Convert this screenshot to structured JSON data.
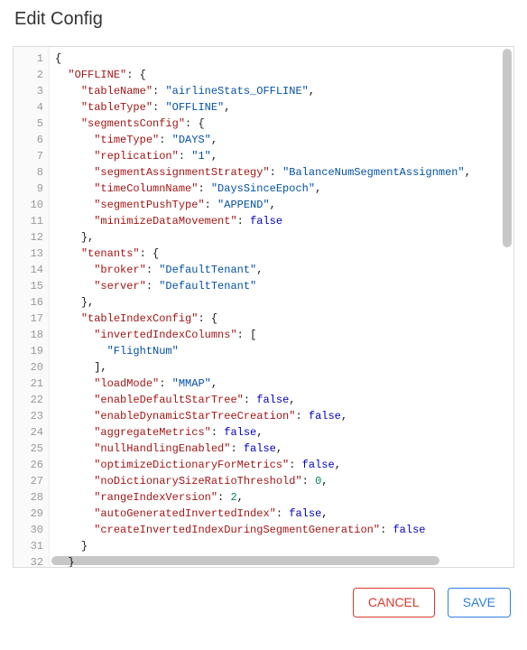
{
  "dialog": {
    "title": "Edit Config",
    "buttons": {
      "cancel": "CANCEL",
      "save": "SAVE"
    }
  },
  "editor": {
    "visible_line_start": 1,
    "visible_line_end": 32,
    "config": {
      "OFFLINE": {
        "tableName": "airlineStats_OFFLINE",
        "tableType": "OFFLINE",
        "segmentsConfig": {
          "timeType": "DAYS",
          "replication": "1",
          "segmentAssignmentStrategy": "BalanceNumSegmentAssignmen",
          "timeColumnName": "DaysSinceEpoch",
          "segmentPushType": "APPEND",
          "minimizeDataMovement": false
        },
        "tenants": {
          "broker": "DefaultTenant",
          "server": "DefaultTenant"
        },
        "tableIndexConfig": {
          "invertedIndexColumns": [
            "FlightNum"
          ],
          "loadMode": "MMAP",
          "enableDefaultStarTree": false,
          "enableDynamicStarTreeCreation": false,
          "aggregateMetrics": false,
          "nullHandlingEnabled": false,
          "optimizeDictionaryForMetrics": false,
          "noDictionarySizeRatioThreshold": 0,
          "rangeIndexVersion": 2,
          "autoGeneratedInvertedIndex": false,
          "createInvertedIndexDuringSegmentGeneration": false
        }
      }
    }
  }
}
